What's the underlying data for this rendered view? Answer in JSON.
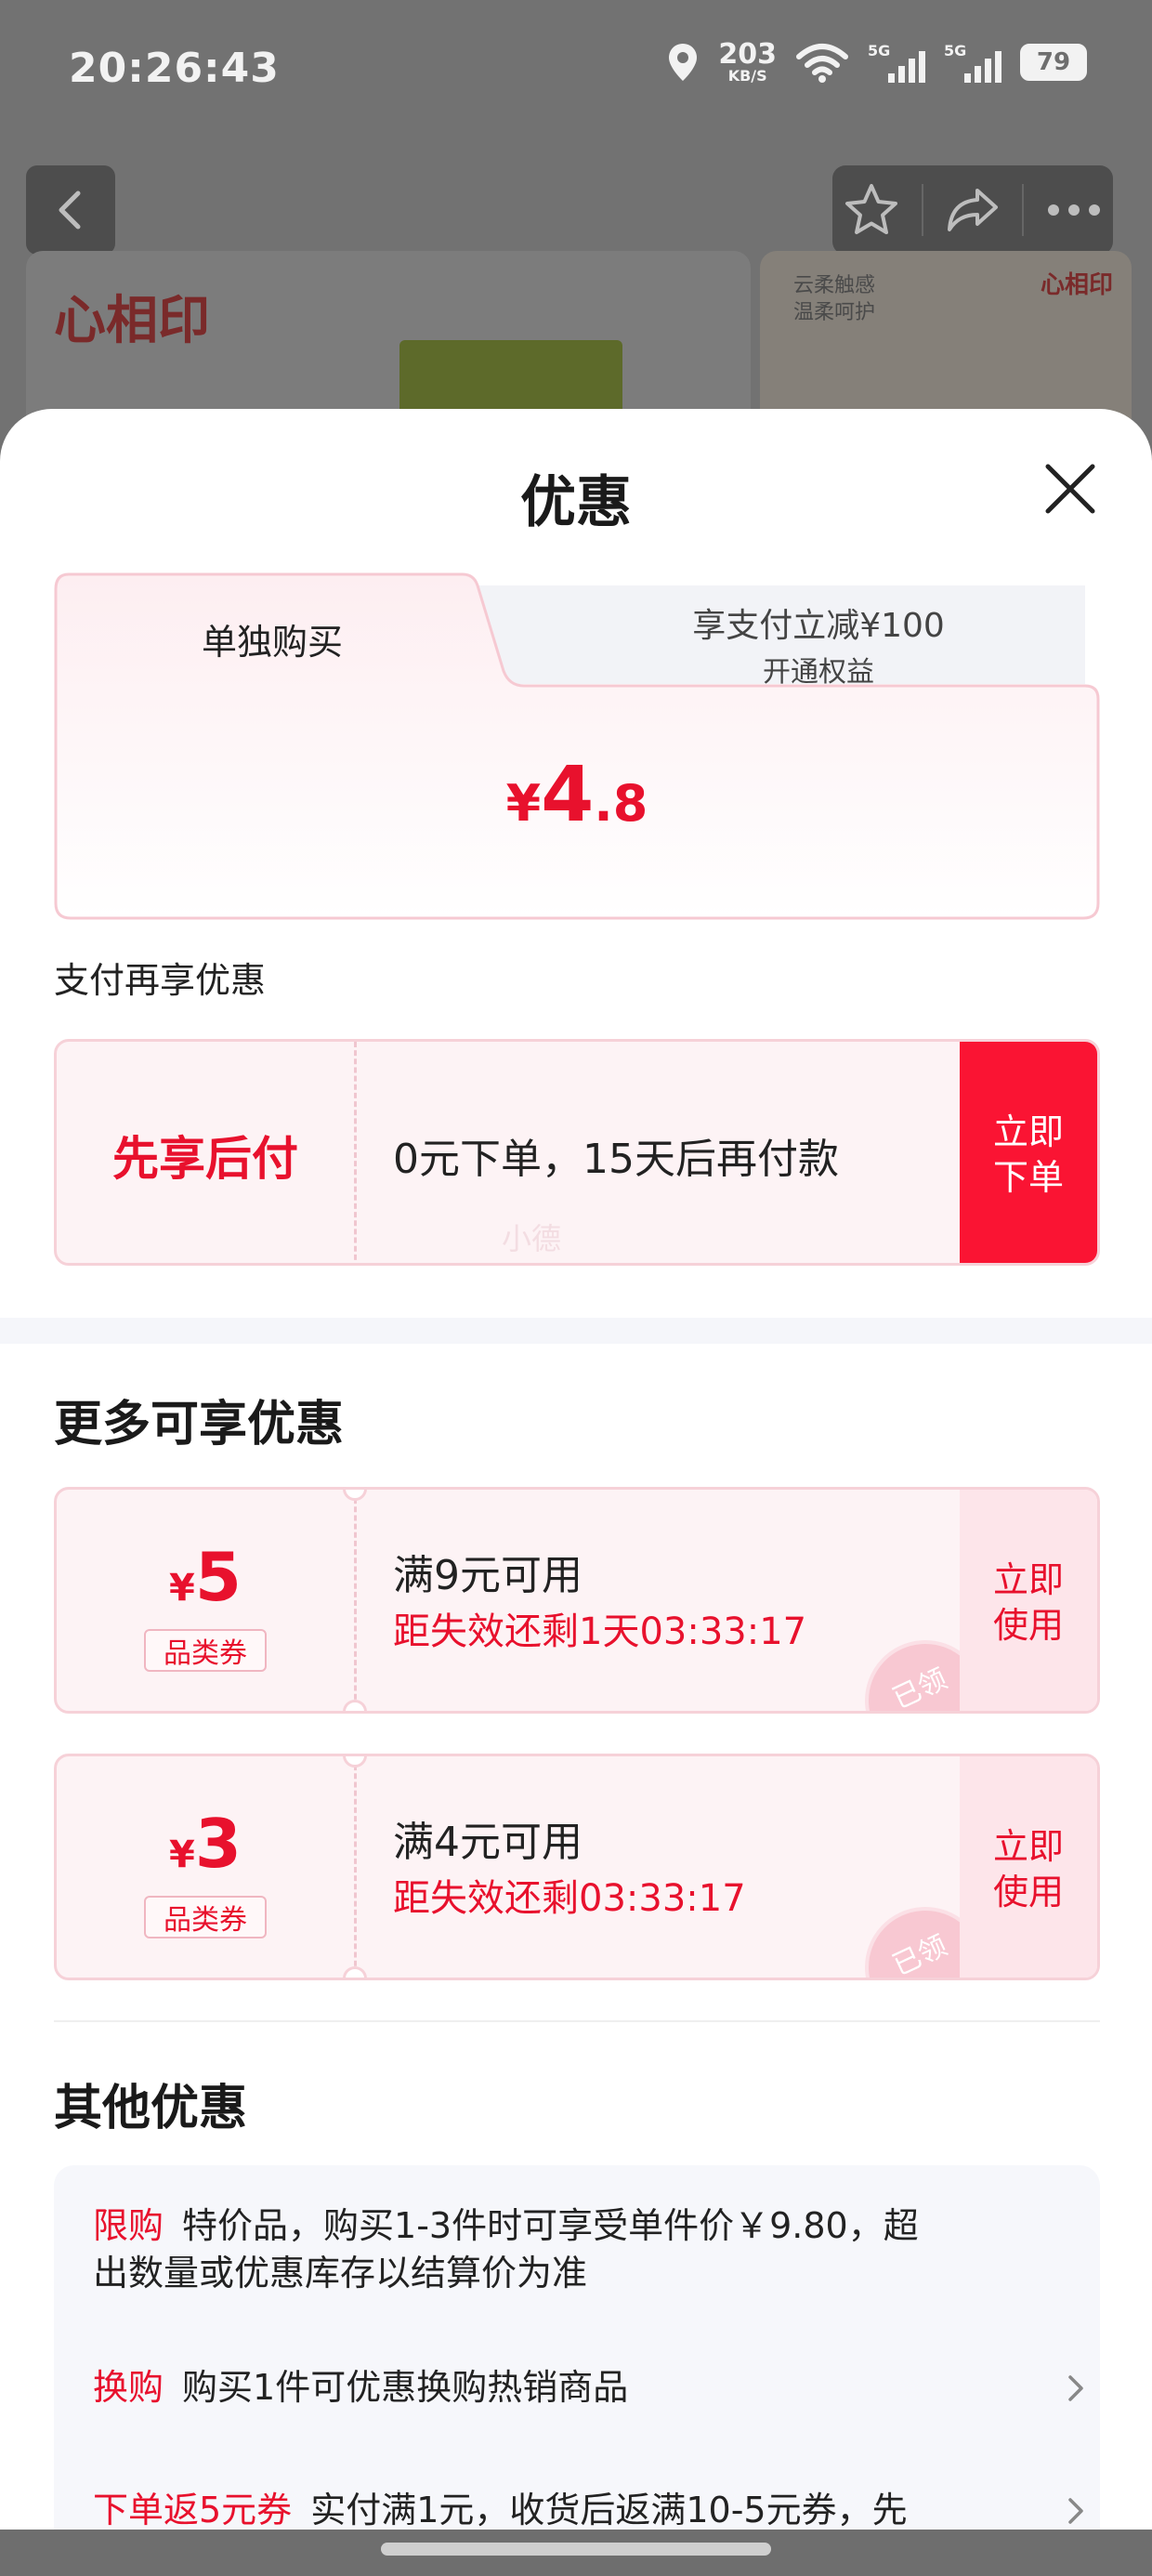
{
  "status_bar": {
    "time": "20:26:43",
    "net_speed_value": "203",
    "net_speed_unit": "KB/S",
    "signal1_label": "5G",
    "signal2_label": "5G",
    "battery": "79"
  },
  "background": {
    "brand_logo": "心相印",
    "banner_text_line1": "云柔触感",
    "banner_text_line2": "温柔呵护",
    "banner_logo_small": "心相印"
  },
  "sheet": {
    "title": "优惠"
  },
  "price_card": {
    "tab_single": "单独购买",
    "tab_member_line1": "享支付立减¥100",
    "tab_member_line2": "开通权益",
    "price_currency": "¥",
    "price_int": "4",
    "price_dec": ".8"
  },
  "pay_more": {
    "label": "支付再享优惠",
    "pay_later_title": "先享后付",
    "pay_later_desc": "0元下单，15天后再付款",
    "button_line1": "立即",
    "button_line2": "下单",
    "watermark": "小德"
  },
  "more_offers": {
    "title": "更多可享优惠",
    "coupons": [
      {
        "currency": "¥",
        "amount": "5",
        "type": "品类券",
        "condition": "满9元可用",
        "expire": "距失效还剩1天03:33:17",
        "button_line1": "立即",
        "button_line2": "使用",
        "stamp": "已领"
      },
      {
        "currency": "¥",
        "amount": "3",
        "type": "品类券",
        "condition": "满4元可用",
        "expire": "距失效还剩03:33:17",
        "button_line1": "立即",
        "button_line2": "使用",
        "stamp": "已领"
      }
    ]
  },
  "other_offers": {
    "title": "其他优惠",
    "items": [
      {
        "tag": "限购",
        "text_line1": "特价品，购买1-3件时可享受单件价￥9.80，超",
        "text_line2": "出数量或优惠库存以结算价为准"
      },
      {
        "tag": "换购",
        "text_line1": "购买1件可优惠换购热销商品"
      },
      {
        "tag": "下单返5元券",
        "text_line1": "实付满1元，收货后返满10-5元券，先"
      }
    ]
  },
  "colors": {
    "accent_red": "#e8112d",
    "button_red": "#fa1433",
    "card_pink": "#fdf3f5"
  }
}
